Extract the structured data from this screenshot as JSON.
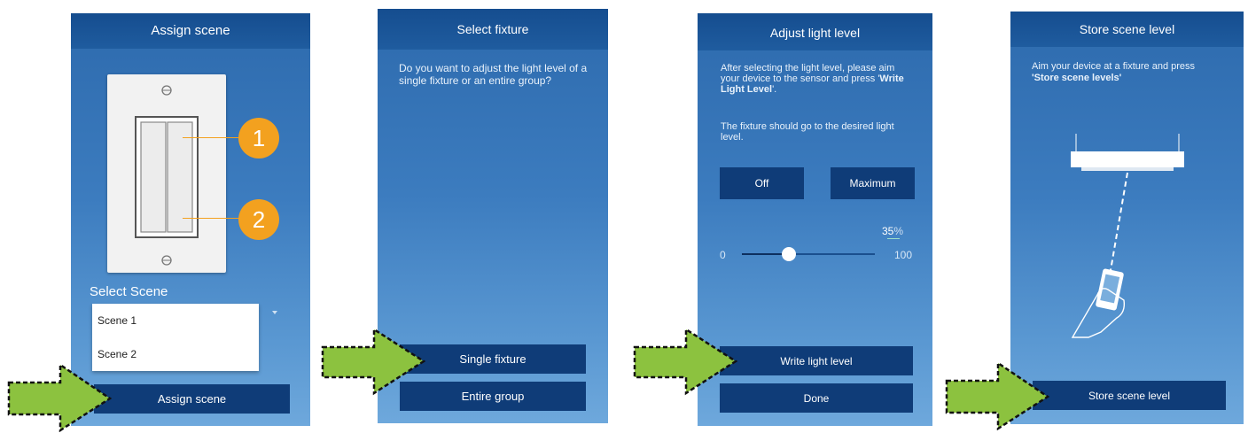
{
  "screen1": {
    "title": "Assign scene",
    "badge1": "1",
    "badge2": "2",
    "select_label": "Select Scene",
    "options": [
      "Scene 1",
      "Scene 2"
    ],
    "button": "Assign scene"
  },
  "screen2": {
    "title": "Select fixture",
    "prompt": "Do you want to adjust the light level of a single fixture or an entire group?",
    "button_single": "Single fixture",
    "button_group": "Entire group"
  },
  "screen3": {
    "title": "Adjust light level",
    "prompt_a1": "After selecting the light level, please aim your device to the sensor and press '",
    "prompt_a_bold": "Write Light Level",
    "prompt_a2": "'.",
    "prompt_b": "The fixture should go to the desired light level.",
    "button_off": "Off",
    "button_max": "Maximum",
    "slider_value": "35",
    "slider_unit": "%",
    "slider_min": "0",
    "slider_max": "100",
    "slider_fraction": 0.35,
    "button_write": "Write light level",
    "button_done": "Done"
  },
  "screen4": {
    "title": "Store scene level",
    "prompt_1": "Aim your device at a fixture and press",
    "prompt_bold": "'Store scene levels'",
    "button": "Store scene level"
  },
  "colors": {
    "screen_gradient_top": "#2d6aad",
    "screen_gradient_bottom": "#6ea8dc",
    "header": "#154d8f",
    "button": "#0f3c78",
    "badge": "#f3a11f",
    "arrow_fill": "#8cc23f"
  },
  "icons": [
    "pointer-arrow-icon",
    "wall-switch-icon",
    "dropdown-caret-icon",
    "ceiling-fixture-icon",
    "hand-phone-icon"
  ]
}
